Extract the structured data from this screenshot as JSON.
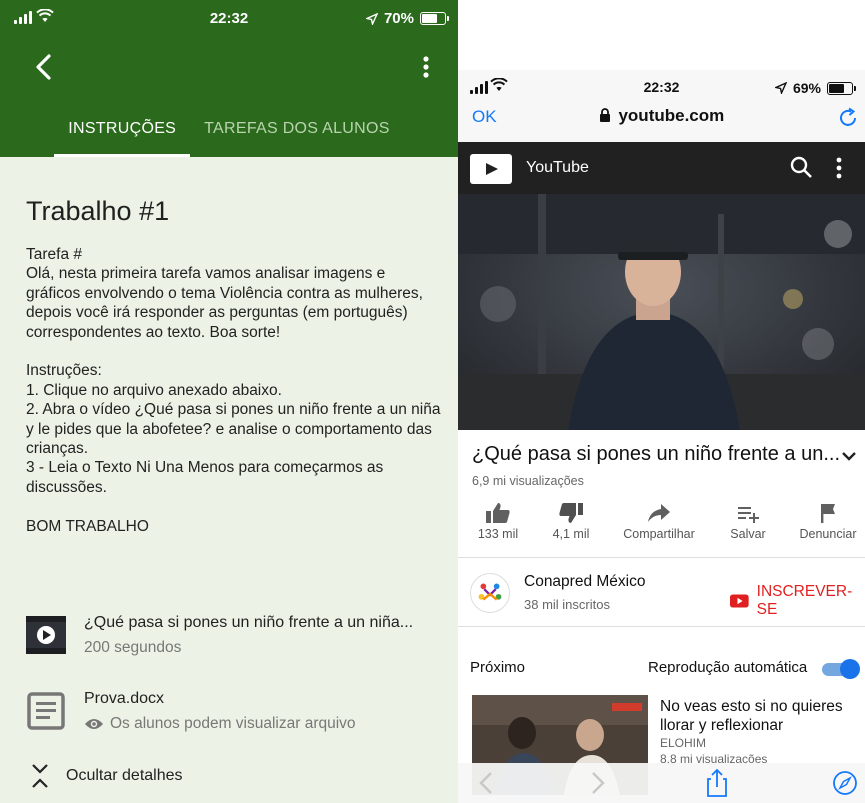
{
  "left_screen": {
    "status_bar": {
      "time": "22:32",
      "battery": "70%",
      "battery_level": 0.7
    },
    "tabs": [
      {
        "label": "INSTRUÇÕES",
        "active": true
      },
      {
        "label": "TAREFAS DOS ALUNOS",
        "active": false
      }
    ],
    "assignment": {
      "title": "Trabalho #1",
      "body": "Tarefa #\nOlá, nesta primeira tarefa vamos analisar imagens e gráficos envolvendo o tema Violência contra as mulheres, depois você irá responder as perguntas (em português) correspondentes ao texto. Boa sorte!\n\nInstruções:\n1. Clique no arquivo anexado abaixo.\n2. Abra o vídeo ¿Qué pasa si pones un niño frente a un niña y le pides que la abofetee? e analise o comportamento das crianças.\n3 - Leia o Texto Ni Una Menos para começarmos as discussões.\n\nBOM TRABALHO"
    },
    "attachments": [
      {
        "title": "¿Qué pasa si pones un niño frente a un niña...",
        "subtitle": "200 segundos",
        "icon": "video-thumbnail"
      },
      {
        "title": "Prova.docx",
        "subtitle": "Os alunos podem visualizar arquivo",
        "icon": "document-icon"
      }
    ],
    "hide_details": "Ocultar detalhes",
    "colors": {
      "header": "#2b6a1d",
      "background": "#ecf3e6"
    }
  },
  "right_screen": {
    "status_bar": {
      "time": "22:32",
      "battery": "69%",
      "battery_level": 0.69
    },
    "browser": {
      "ok": "OK",
      "url": "youtube.com"
    },
    "youtube": {
      "brand": "YouTube",
      "video_title": "¿Qué pasa si pones un niño frente a un...",
      "views": "6,9 mi visualizações",
      "actions": [
        {
          "label": "133 mil",
          "icon": "thumbs-up-icon"
        },
        {
          "label": "4,1 mil",
          "icon": "thumbs-down-icon"
        },
        {
          "label": "Compartilhar",
          "icon": "share-icon"
        },
        {
          "label": "Salvar",
          "icon": "save-playlist-icon"
        },
        {
          "label": "Denunciar",
          "icon": "flag-icon"
        }
      ],
      "channel": {
        "name": "Conapred México",
        "subscribers": "38 mil inscritos"
      },
      "subscribe": "INSCREVER-SE",
      "next_label": "Próximo",
      "autoplay_label": "Reprodução automática",
      "autoplay_on": true,
      "recommended": {
        "title": "No veas esto si no quieres llorar y reflexionar",
        "channel": "ELOHIM",
        "views": "8,8 mi visualizações"
      }
    },
    "colors": {
      "link_blue": "#1479fb",
      "subscribe_red": "#e02020",
      "toggle_blue": "#1a73e8"
    }
  }
}
